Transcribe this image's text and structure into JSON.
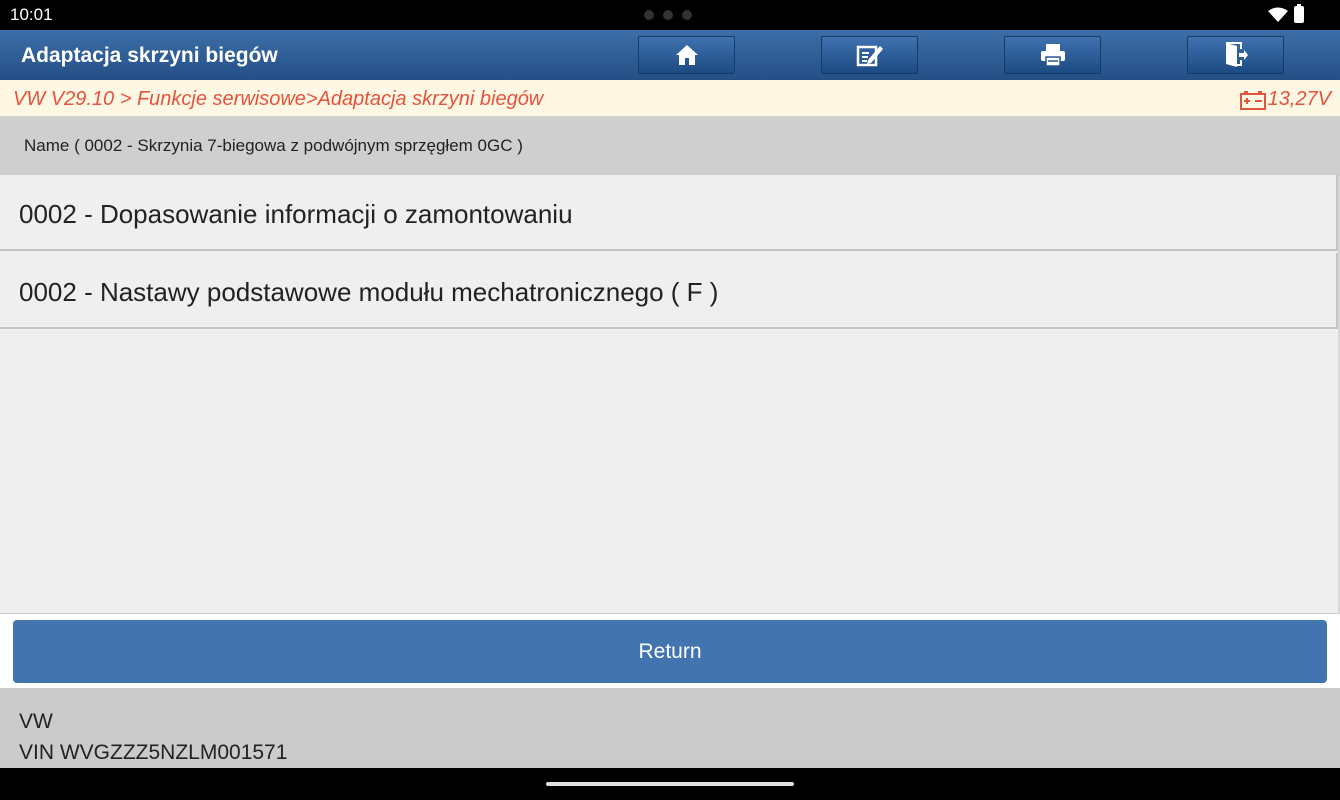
{
  "status_bar": {
    "time": "10:01",
    "wifi_icon": "wifi-icon",
    "battery_icon": "battery-icon"
  },
  "header": {
    "title": "Adaptacja skrzyni biegów",
    "buttons": [
      {
        "icon": "home-icon"
      },
      {
        "icon": "edit-icon"
      },
      {
        "icon": "print-icon"
      },
      {
        "icon": "exit-icon"
      }
    ]
  },
  "breadcrumb": {
    "path": "VW V29.10 > Funkcje serwisowe>Adaptacja skrzyni biegów",
    "voltage": "13,27V",
    "accent": "#e4543c"
  },
  "name_bar": {
    "text": "Name ( 0002 - Skrzynia 7-biegowa z podwójnym sprzęgłem 0GC )"
  },
  "list": {
    "items": [
      {
        "label": "0002 - Dopasowanie informacji o zamontowaniu"
      },
      {
        "label": "0002 - Nastawy podstawowe modułu mechatronicznego ( F )"
      }
    ]
  },
  "return_button": {
    "label": "Return",
    "color": "#4274af"
  },
  "footer": {
    "make": "VW",
    "vin": "VIN WVGZZZ5NZLM001571"
  }
}
